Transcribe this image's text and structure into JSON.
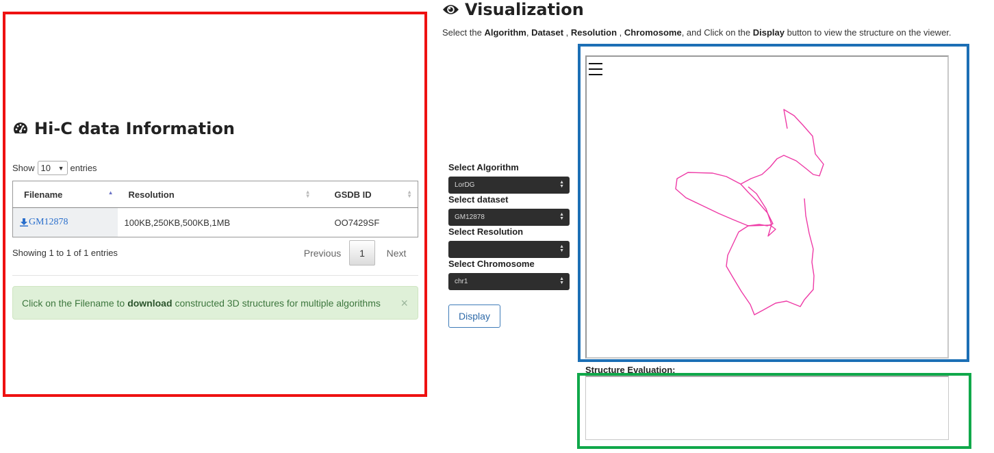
{
  "left_panel": {
    "title": "Hi-C data Information",
    "show_prefix": "Show",
    "show_value": "10",
    "show_suffix": "entries",
    "table": {
      "columns": [
        "Filename",
        "Resolution",
        "GSDB ID"
      ],
      "rows": [
        {
          "filename": "GM12878",
          "resolution": "100KB,250KB,500KB,1MB",
          "gsdb_id": "OO7429SF"
        }
      ]
    },
    "info": "Showing 1 to 1 of 1 entries",
    "pager": {
      "previous": "Previous",
      "page": "1",
      "next": "Next"
    },
    "alert": {
      "before": "Click on the Filename to",
      "bold": "download",
      "after": "constructed 3D structures for multiple algorithms",
      "close": "×"
    }
  },
  "right_panel": {
    "title": "Visualization",
    "instruction": {
      "p1": "Select the ",
      "b1": "Algorithm",
      "p2": ", ",
      "b2": "Dataset",
      "p3": " , ",
      "b3": "Resolution",
      "p4": " , ",
      "b4": "Chromosome",
      "p5": ", and Click on the ",
      "b5": "Display",
      "p6": " button to view the structure on the viewer."
    },
    "controls": {
      "algorithm_label": "Select Algorithm",
      "algorithm_value": "LorDG",
      "dataset_label": "Select dataset",
      "dataset_value": "GM12878",
      "resolution_label": "Select Resolution",
      "resolution_value": "",
      "chromosome_label": "Select Chromosome",
      "chromosome_value": "chr1"
    },
    "display_button": "Display",
    "evaluation_label": "Structure Evaluation:"
  },
  "colors": {
    "annotation_red": "#ee1111",
    "annotation_blue": "#1c6fb5",
    "annotation_green": "#10a84a",
    "structure_line": "#ee3aa6",
    "alert_bg": "#dff0d8",
    "link": "#2a6fcc"
  },
  "icons": [
    "dashboard-icon",
    "download-icon",
    "eye-icon",
    "menu-icon",
    "sort-icon",
    "close-icon"
  ]
}
